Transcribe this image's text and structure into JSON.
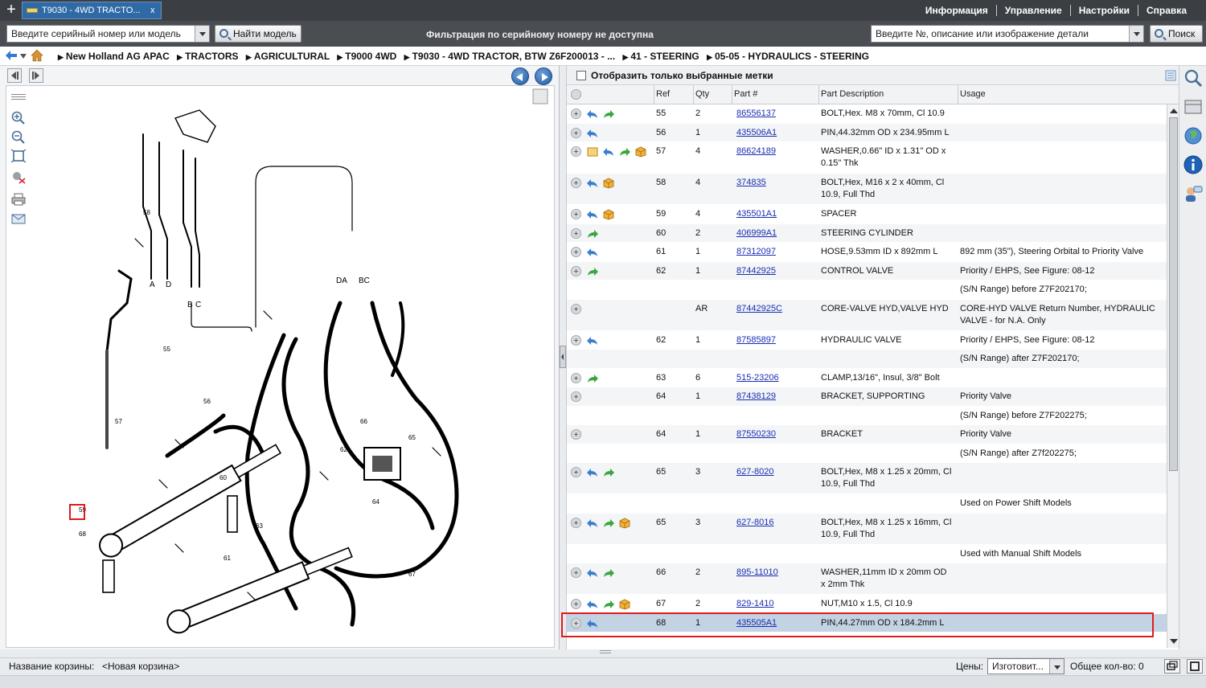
{
  "window": {
    "tab_title": "T9030 - 4WD TRACTO...",
    "tab_close": "x"
  },
  "top_menu": [
    "Информация",
    "Управление",
    "Настройки",
    "Справка"
  ],
  "toolbar": {
    "serial_placeholder": "Введите серийный номер или модель",
    "find_model_label": "Найти модель",
    "filter_note": "Фильтрация по серийному номеру не доступна",
    "part_search_placeholder": "Введите №, описание или изображение детали",
    "search_label": "Поиск"
  },
  "breadcrumb": [
    "New Holland AG APAC",
    "TRACTORS",
    "AGRICULTURAL",
    "T9000 4WD",
    "T9030 - 4WD TRACTOR, BTW Z6F200013 - ...",
    "41 - STEERING",
    "05-05 - HYDRAULICS - STEERING"
  ],
  "parts_panel": {
    "show_selected_label": "Отобразить только выбранные метки",
    "columns": {
      "ref": "Ref",
      "qty": "Qty",
      "part": "Part #",
      "desc": "Part Description",
      "usage": "Usage"
    },
    "rows": [
      {
        "ref": "55",
        "qty": "2",
        "part": "86556137",
        "desc": "BOLT,Hex. M8 x 70mm, Cl 10.9",
        "usage": "",
        "icons": [
          "back",
          "fwd"
        ]
      },
      {
        "ref": "56",
        "qty": "1",
        "part": "435506A1",
        "desc": "PIN,44.32mm OD x 234.95mm L",
        "usage": "",
        "icons": [
          "back"
        ]
      },
      {
        "ref": "57",
        "qty": "4",
        "part": "86624189",
        "desc": "WASHER,0.66\" ID x 1.31\" OD x 0.15\" Thk",
        "usage": "",
        "icons": [
          "note",
          "back",
          "fwd",
          "box"
        ]
      },
      {
        "ref": "58",
        "qty": "4",
        "part": "374835",
        "desc": "BOLT,Hex, M16 x 2 x 40mm, Cl 10.9, Full Thd",
        "usage": "",
        "icons": [
          "back",
          "box"
        ]
      },
      {
        "ref": "59",
        "qty": "4",
        "part": "435501A1",
        "desc": "SPACER",
        "usage": "",
        "icons": [
          "back",
          "box"
        ]
      },
      {
        "ref": "60",
        "qty": "2",
        "part": "406999A1",
        "desc": "STEERING CYLINDER",
        "usage": "",
        "icons": [
          "fwd"
        ]
      },
      {
        "ref": "61",
        "qty": "1",
        "part": "87312097",
        "desc": "HOSE,9.53mm ID x 892mm L",
        "usage": "892 mm (35\"), Steering Orbital to Priority Valve",
        "icons": [
          "back"
        ]
      },
      {
        "ref": "62",
        "qty": "1",
        "part": "87442925",
        "desc": "CONTROL VALVE",
        "usage": "Priority / EHPS, See Figure: 08-12",
        "icons": [
          "fwd"
        ]
      },
      {
        "ref": "",
        "qty": "",
        "part": "",
        "desc": "",
        "usage": "(S/N Range) before Z7F202170;",
        "icons": [],
        "sub": true
      },
      {
        "ref": "",
        "qty": "AR",
        "part": "87442925C",
        "desc": "CORE-VALVE HYD,VALVE HYD",
        "usage": "CORE-HYD VALVE Return Number, HYDRAULIC VALVE - for N.A. Only",
        "icons": []
      },
      {
        "ref": "62",
        "qty": "1",
        "part": "87585897",
        "desc": "HYDRAULIC VALVE",
        "usage": "Priority / EHPS, See Figure: 08-12",
        "icons": [
          "back"
        ]
      },
      {
        "ref": "",
        "qty": "",
        "part": "",
        "desc": "",
        "usage": "(S/N Range) after Z7F202170;",
        "icons": [],
        "sub": true
      },
      {
        "ref": "63",
        "qty": "6",
        "part": "515-23206",
        "desc": "CLAMP,13/16\", Insul, 3/8\" Bolt",
        "usage": "",
        "icons": [
          "fwd"
        ]
      },
      {
        "ref": "64",
        "qty": "1",
        "part": "87438129",
        "desc": "BRACKET, SUPPORTING",
        "usage": "Priority Valve",
        "icons": []
      },
      {
        "ref": "",
        "qty": "",
        "part": "",
        "desc": "",
        "usage": "(S/N Range) before Z7F202275;",
        "icons": [],
        "sub": true
      },
      {
        "ref": "64",
        "qty": "1",
        "part": "87550230",
        "desc": "BRACKET",
        "usage": "Priority Valve",
        "icons": []
      },
      {
        "ref": "",
        "qty": "",
        "part": "",
        "desc": "",
        "usage": "(S/N Range) after Z7f202275;",
        "icons": [],
        "sub": true
      },
      {
        "ref": "65",
        "qty": "3",
        "part": "627-8020",
        "desc": "BOLT,Hex, M8 x 1.25 x 20mm, Cl 10.9, Full Thd",
        "usage": "",
        "icons": [
          "back",
          "fwd"
        ]
      },
      {
        "ref": "",
        "qty": "",
        "part": "",
        "desc": "",
        "usage": "Used on Power Shift Models",
        "icons": [],
        "sub": true
      },
      {
        "ref": "65",
        "qty": "3",
        "part": "627-8016",
        "desc": "BOLT,Hex, M8 x 1.25 x 16mm, Cl 10.9, Full Thd",
        "usage": "",
        "icons": [
          "back",
          "fwd",
          "box"
        ]
      },
      {
        "ref": "",
        "qty": "",
        "part": "",
        "desc": "",
        "usage": "Used with Manual Shift Models",
        "icons": [],
        "sub": true
      },
      {
        "ref": "66",
        "qty": "2",
        "part": "895-11010",
        "desc": "WASHER,11mm ID x 20mm OD x 2mm Thk",
        "usage": "",
        "icons": [
          "back",
          "fwd"
        ]
      },
      {
        "ref": "67",
        "qty": "2",
        "part": "829-1410",
        "desc": "NUT,M10 x 1.5, Cl 10.9",
        "usage": "",
        "icons": [
          "back",
          "fwd",
          "box"
        ]
      },
      {
        "ref": "68",
        "qty": "1",
        "part": "435505A1",
        "desc": "PIN,44.27mm OD x 184.2mm L",
        "usage": "",
        "icons": [
          "back"
        ],
        "selected": true
      }
    ]
  },
  "bottom": {
    "cart_label": "Название корзины:",
    "cart_value": "<Новая корзина>",
    "prices_label": "Цены:",
    "prices_value": "Изготовит...",
    "total_label": "Общее кол-во: 0"
  },
  "diagram": {
    "labels": [
      "A",
      "D",
      "B",
      "C",
      "DA",
      "BC",
      "55",
      "56",
      "57",
      "58",
      "59",
      "60",
      "61",
      "62",
      "63",
      "64",
      "65",
      "66",
      "67",
      "68"
    ],
    "hotspot": "68"
  },
  "colors": {
    "accent_tab": "#2f6aa7",
    "topbar": "#3b3f44",
    "selected_row": "#c3d3e4",
    "highlight": "#e01b1b",
    "link": "#1a2eb0"
  }
}
